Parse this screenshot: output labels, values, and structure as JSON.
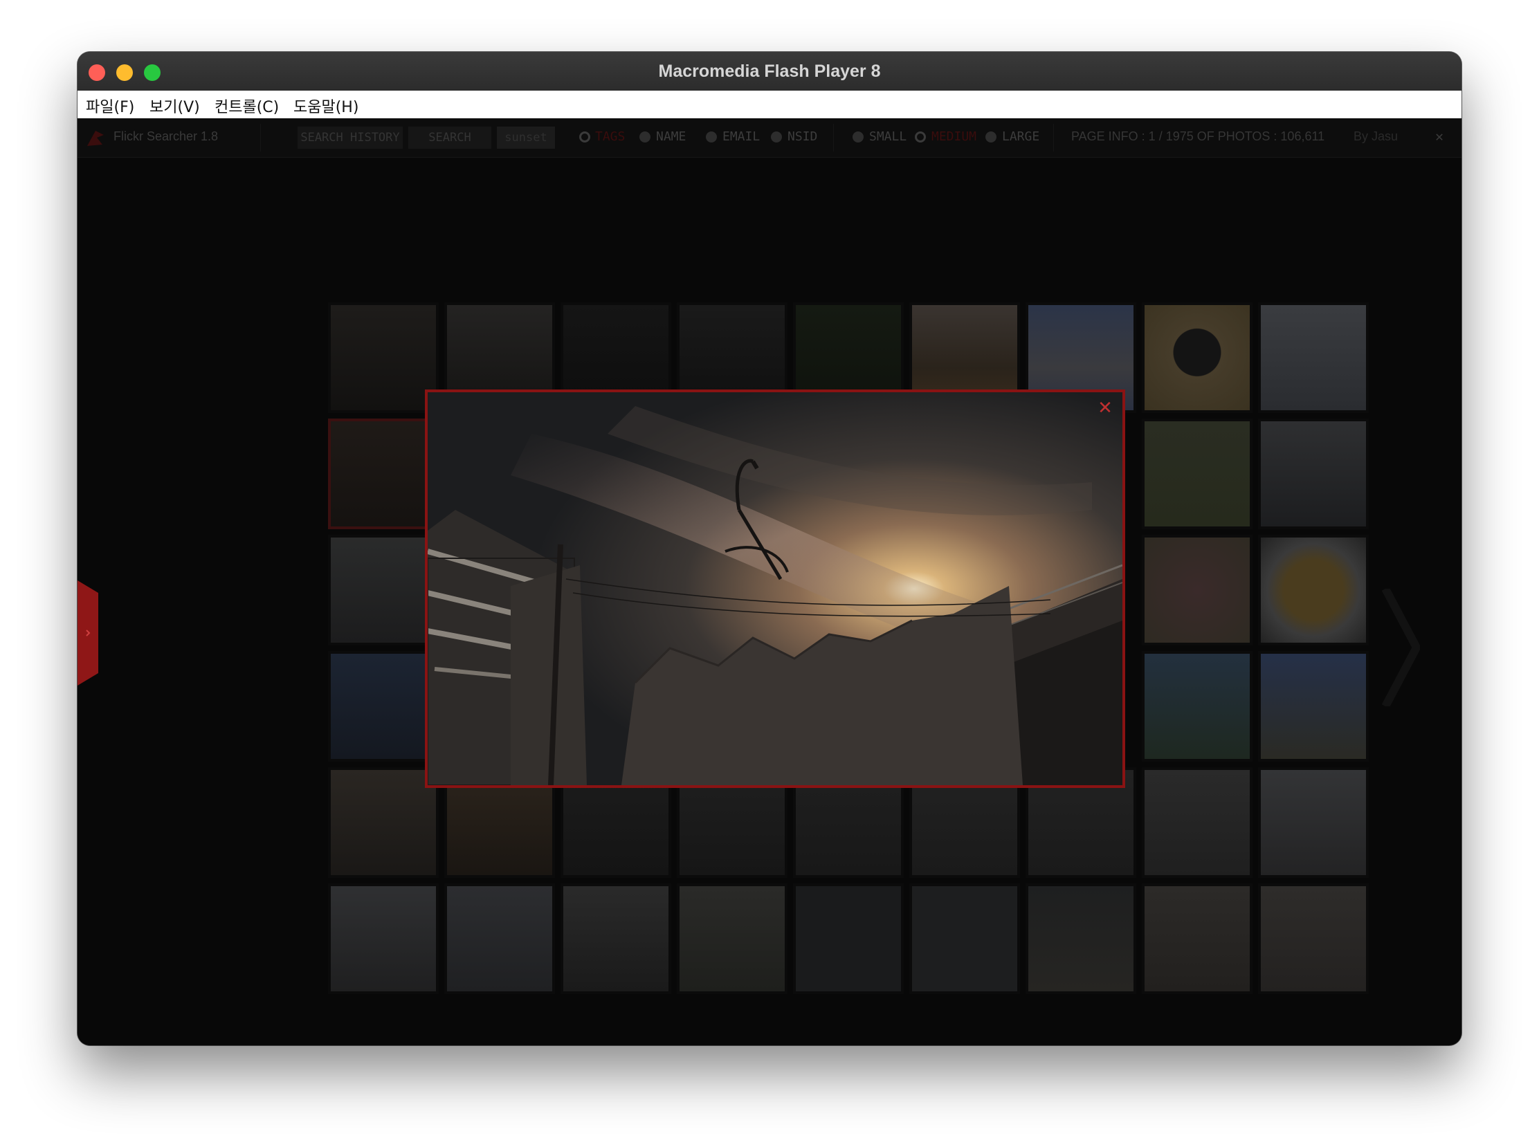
{
  "window": {
    "title": "Macromedia Flash Player 8"
  },
  "menu": [
    "파일(F)",
    "보기(V)",
    "컨트롤(C)",
    "도움말(H)"
  ],
  "toolbar": {
    "app_name": "Flickr Searcher 1.8",
    "search_history": "SEARCH HISTORY",
    "search": "SEARCH",
    "query": "sunset",
    "search_modes": [
      "TAGS",
      "NAME",
      "EMAIL",
      "NSID"
    ],
    "selected_mode": "TAGS",
    "sizes": [
      "SMALL",
      "MEDIUM",
      "LARGE"
    ],
    "selected_size": "MEDIUM",
    "page_info": "PAGE INFO : 1 / 1975 OF PHOTOS : 106,611",
    "author": "By Jasu",
    "close_glyph": "✕"
  },
  "popup": {
    "close_glyph": "✕"
  },
  "colors": {
    "accent_red": "#8a1313",
    "background": "#080808"
  }
}
